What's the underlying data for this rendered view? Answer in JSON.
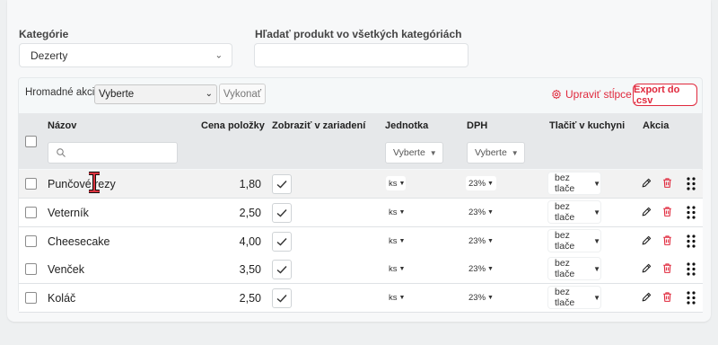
{
  "filters": {
    "category_label": "Kategórie",
    "category_value": "Dezerty",
    "search_label": "Hľadať produkt vo všetkých kategóriách",
    "search_value": ""
  },
  "toolbar": {
    "bulk_label": "Hromadné akcie:",
    "bulk_value": "Vyberte",
    "execute_label": "Vykonať",
    "columns_label": "Upraviť stĺpce",
    "export_label": "Export do .csv"
  },
  "table": {
    "headers": {
      "name": "Názov",
      "price": "Cena položky",
      "show": "Zobraziť v zariadení",
      "unit": "Jednotka",
      "vat": "DPH",
      "kitchen": "Tlačiť v kuchyni",
      "action": "Akcia"
    },
    "unit_filter": "Vyberte",
    "vat_filter": "Vyberte",
    "rows": [
      {
        "name": "Punčové rezy",
        "price": "1,80",
        "unit": "ks",
        "vat": "23%",
        "kitchen": "bez tlače"
      },
      {
        "name": "Veterník",
        "price": "2,50",
        "unit": "ks",
        "vat": "23%",
        "kitchen": "bez tlače"
      },
      {
        "name": "Cheesecake",
        "price": "4,00",
        "unit": "ks",
        "vat": "23%",
        "kitchen": "bez tlače"
      },
      {
        "name": "Venček",
        "price": "3,50",
        "unit": "ks",
        "vat": "23%",
        "kitchen": "bez tlače"
      },
      {
        "name": "Koláč",
        "price": "2,50",
        "unit": "ks",
        "vat": "23%",
        "kitchen": "bez tlače"
      }
    ]
  },
  "colors": {
    "accent": "#e0283c",
    "header_bg": "#e6e8ea"
  },
  "icons": [
    "chevron-down-icon",
    "search-icon",
    "gear-icon",
    "check-icon",
    "pencil-icon",
    "trash-icon",
    "drag-handle-icon",
    "text-cursor-icon"
  ]
}
